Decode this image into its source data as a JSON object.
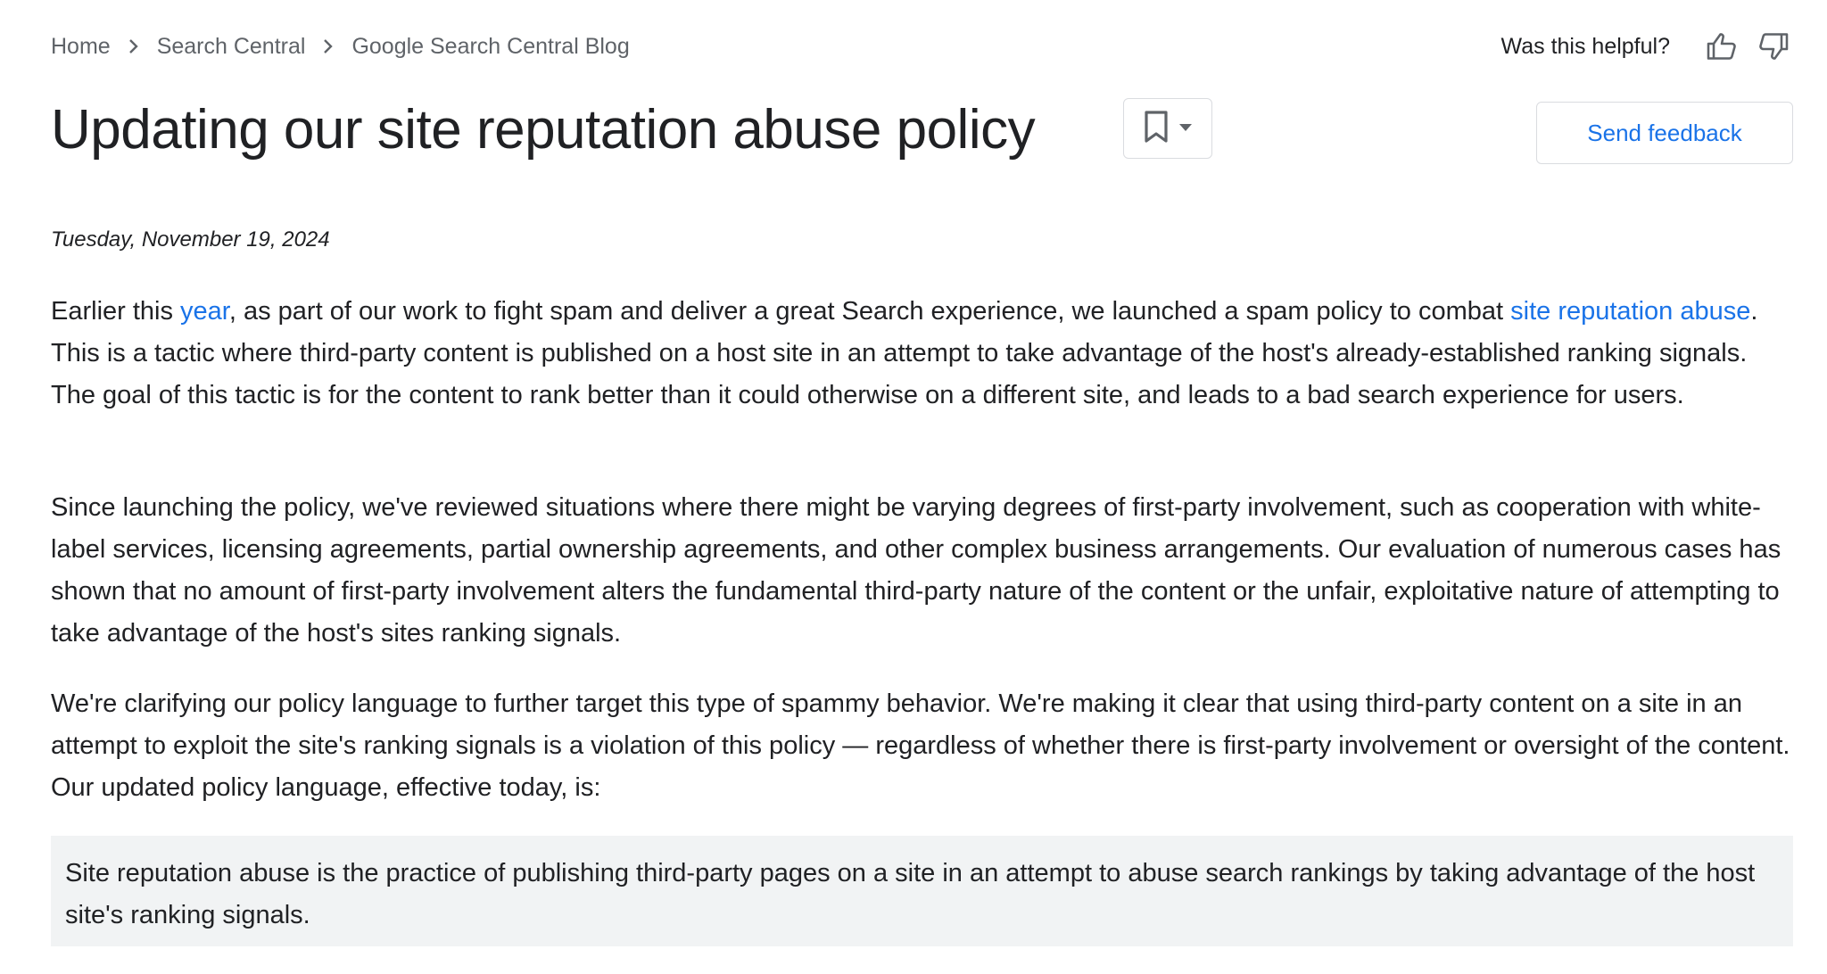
{
  "breadcrumb": {
    "items": [
      "Home",
      "Search Central",
      "Google Search Central Blog"
    ]
  },
  "helpful": {
    "label": "Was this helpful?"
  },
  "header": {
    "title": "Updating our site reputation abuse policy",
    "feedback_label": "Send feedback"
  },
  "article": {
    "date": "Tuesday, November 19, 2024",
    "p1": {
      "t1": "Earlier this ",
      "link1": "year",
      "t2": ", as part of our work to fight spam and deliver a great Search experience, we launched a spam policy to combat ",
      "link2": "site reputation abuse",
      "t3": ". This is a tactic where third-party content is published on a host site in an attempt to take advantage of the host's already-established ranking signals. The goal of this tactic is for the content to rank better than it could otherwise on a different site, and leads to a bad search experience for users."
    },
    "p2": "Since launching the policy, we've reviewed situations where there might be varying degrees of first-party involvement, such as cooperation with white-label services, licensing agreements, partial ownership agreements, and other complex business arrangements. Our evaluation of numerous cases has shown that no amount of first-party involvement alters the fundamental third-party nature of the content or the unfair, exploitative nature of attempting to take advantage of the host's sites ranking signals.",
    "p3": "We're clarifying our policy language to further target this type of spammy behavior. We're making it clear that using third-party content on a site in an attempt to exploit the site's ranking signals is a violation of this policy — regardless of whether there is first-party involvement or oversight of the content. Our updated policy language, effective today, is:",
    "quote": "Site reputation abuse is the practice of publishing third-party pages on a site in an attempt to abuse search rankings by taking advantage of the host site's ranking signals."
  },
  "icons": {
    "separator": "chevron-right-icon",
    "helpful_yes": "thumb-up-icon",
    "helpful_no": "thumb-down-icon",
    "bookmark": "bookmark-icon",
    "dropdown": "arrow-drop-down-icon"
  },
  "colors": {
    "link": "#1a73e8",
    "text": "#202124",
    "muted": "#5f6368",
    "quote_bg": "#f1f3f4",
    "border": "#dadce0"
  }
}
